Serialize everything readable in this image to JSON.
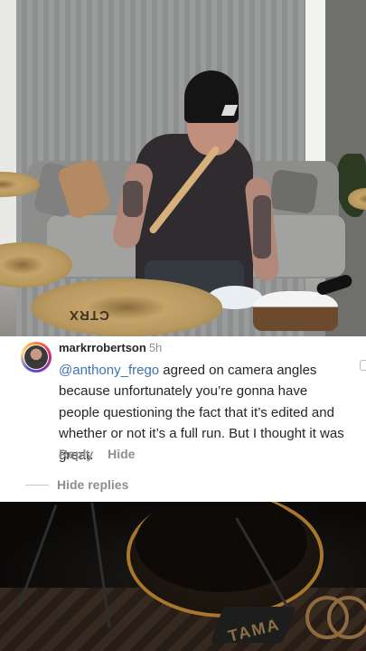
{
  "video": {
    "top_frame": {
      "cymbal_brand": "CTRX"
    },
    "bottom_frame": {
      "drum_brand": "TAMA"
    }
  },
  "comment": {
    "username": "markrrobertson",
    "timestamp": "5h",
    "mention": "@anthony_frego",
    "text": " agreed on camera angles because unfortunately you’re gonna have people questioning the fact that it’s edited and whether or not it’s a full run. But I thought it was great.",
    "reply_label": "Reply",
    "hide_label": "Hide",
    "hide_replies_label": "Hide replies"
  },
  "colors": {
    "mention": "#3f72af",
    "username": "#262626",
    "secondary_text": "#8e8e8e",
    "panel_background": "#ffffff"
  }
}
